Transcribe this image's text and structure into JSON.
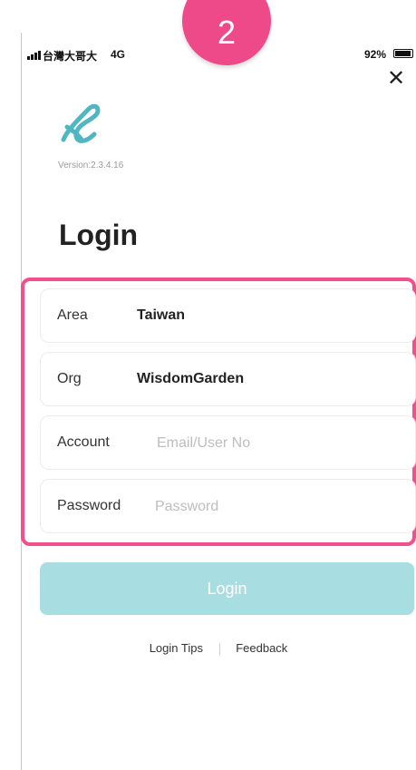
{
  "step_badge": "2",
  "status_bar": {
    "carrier": "台灣大哥大",
    "network": "4G",
    "battery": "92%"
  },
  "app": {
    "version": "Version:2.3.4.16",
    "title": "Login"
  },
  "form": {
    "area_label": "Area",
    "area_value": "Taiwan",
    "org_label": "Org",
    "org_value": "WisdomGarden",
    "account_label": "Account",
    "account_placeholder": "Email/User No",
    "password_label": "Password",
    "password_placeholder": "Password"
  },
  "login_button": "Login",
  "links": {
    "tips": "Login Tips",
    "feedback": "Feedback"
  },
  "colors": {
    "highlight": "#f1508c",
    "badge": "#ee4a8a",
    "login_button_bg": "#a8dde2",
    "logo": "#4fb6c2"
  },
  "icons": [
    "close-icon",
    "app-logo-icon",
    "signal-icon",
    "battery-icon"
  ]
}
